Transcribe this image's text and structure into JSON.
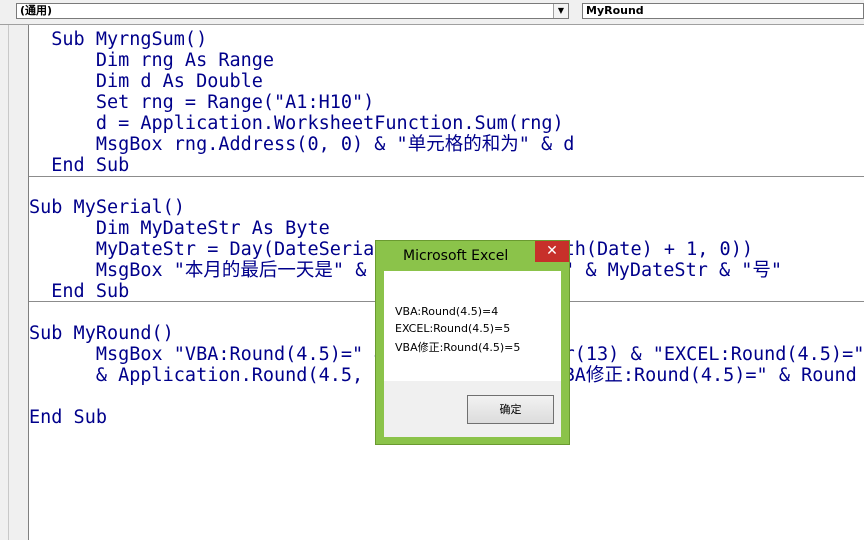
{
  "combo": {
    "procedure_scope": "(通用)",
    "procedure_name": "MyRound"
  },
  "code_lines": [
    {
      "text": "  Sub MyrngSum()"
    },
    {
      "text": "      Dim rng As Range"
    },
    {
      "text": "      Dim d As Double"
    },
    {
      "text": "      Set rng = Range(\"A1:H10\")"
    },
    {
      "text": "      d = Application.WorksheetFunction.Sum(rng)"
    },
    {
      "text": "      MsgBox rng.Address(0, 0) & \"单元格的和为\" & d"
    },
    {
      "text": "  End Sub"
    },
    {
      "text": ""
    },
    {
      "text": "Sub MySerial()"
    },
    {
      "text": "      Dim MyDateStr As Byte"
    },
    {
      "text": "      MyDateStr = Day(DateSerial(Year(Date), Month(Date) + 1, 0))"
    },
    {
      "text": "      MsgBox \"本月的最后一天是\" & Month(Date) & \"月\" & MyDateStr & \"号\""
    },
    {
      "text": "  End Sub"
    },
    {
      "text": ""
    },
    {
      "text": "Sub MyRound()"
    },
    {
      "text": "      MsgBox \"VBA:Round(4.5)=\" & Round(4.5) & Chr(13) & \"EXCEL:Round(4.5)=\""
    },
    {
      "text": "      & Application.Round(4.5, 0) & Chr(13) & \"VBA修正:Round(4.5)=\" & Round"
    },
    {
      "text": ""
    },
    {
      "text": "End Sub"
    }
  ],
  "dialog": {
    "title": "Microsoft Excel",
    "close_label": "✕",
    "lines": [
      "VBA:Round(4.5)=4",
      "EXCEL:Round(4.5)=5",
      "VBA修正:Round(4.5)=5"
    ],
    "ok_label": "确定"
  },
  "combo_arrow": "▼",
  "colors": {
    "code_text": "#00008b",
    "dialog_frame": "#8bc34a",
    "close_button": "#c7302a"
  }
}
